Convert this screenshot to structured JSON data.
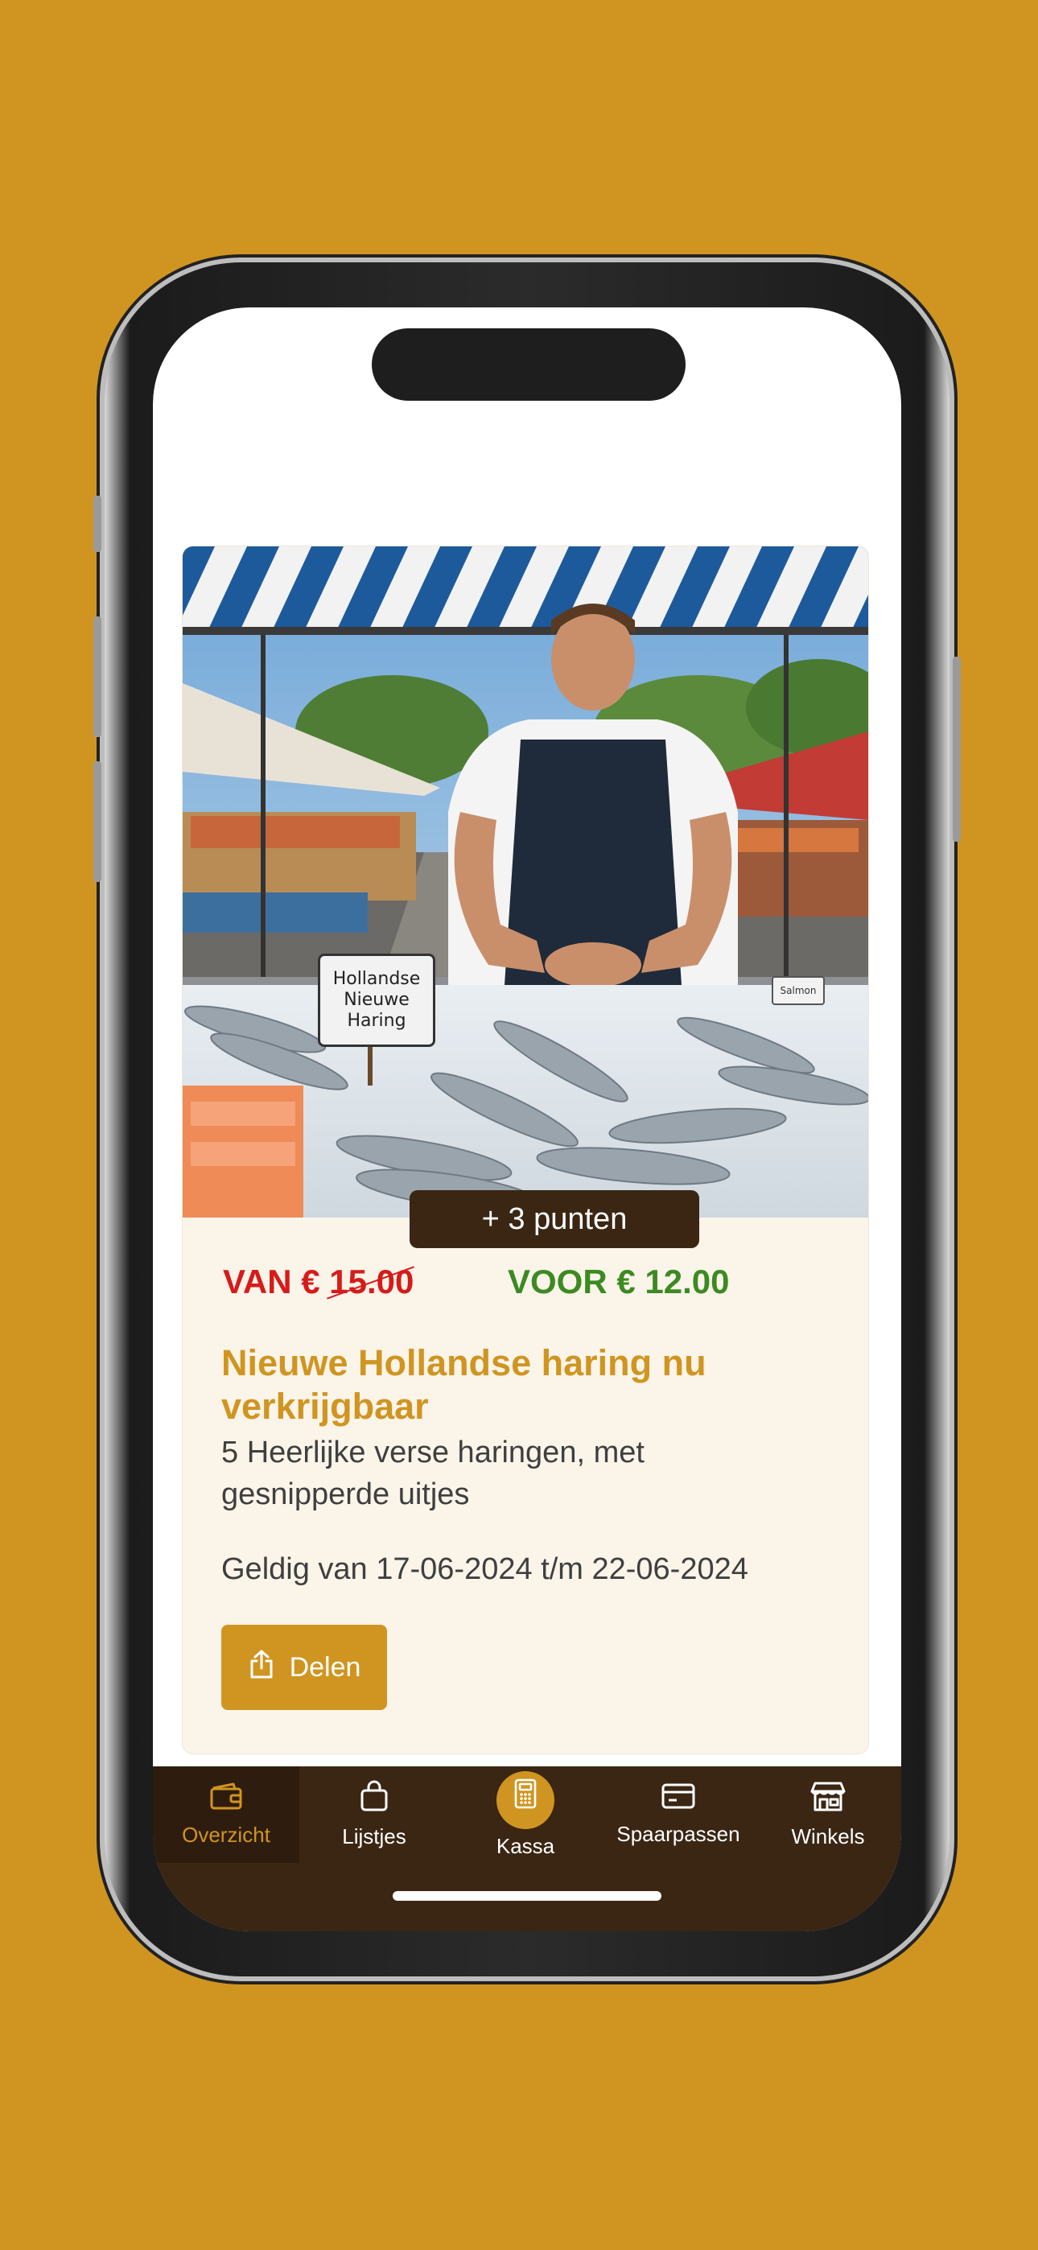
{
  "colors": {
    "background": "#D09521",
    "accent": "#D09521",
    "tab_bar": "#3A2613",
    "card_bg": "#FAF4E9",
    "price_old": "#D61B1B",
    "price_new": "#3C8A22"
  },
  "promo": {
    "image_signs": {
      "haring_sign": "Hollandse\nNieuwe\nHaring",
      "salmon_sign": "Salmon"
    },
    "points_badge": "+ 3 punten",
    "price_old_prefix": "VAN € ",
    "price_old_amount": "15.00",
    "price_new": "VOOR € 12.00",
    "title": "Nieuwe Hollandse haring nu verkrijgbaar",
    "description": "5 Heerlijke verse haringen, met gesnipperde uitjes",
    "validity": "Geldig van 17-06-2024 t/m 22-06-2024",
    "share_label": "Delen",
    "share_icon": "share-icon"
  },
  "tabs": [
    {
      "label": "Overzicht",
      "icon": "wallet-icon",
      "active": true
    },
    {
      "label": "Lijstjes",
      "icon": "shopping-bag-icon",
      "active": false
    },
    {
      "label": "Kassa",
      "icon": "calculator-icon",
      "active": false
    },
    {
      "label": "Spaarpassen",
      "icon": "card-icon",
      "active": false
    },
    {
      "label": "Winkels",
      "icon": "store-icon",
      "active": false
    }
  ]
}
